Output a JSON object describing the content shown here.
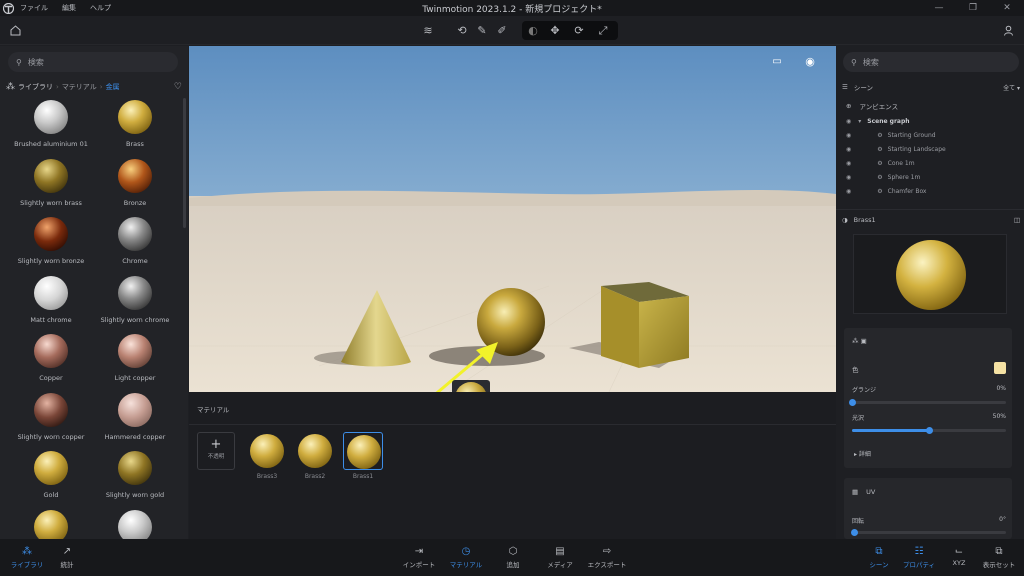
{
  "titlebar": {
    "app_title": "Twinmotion 2023.1.2 - 新規プロジェクト*",
    "menus": [
      "ファイル",
      "編集",
      "ヘルプ"
    ]
  },
  "left_panel": {
    "search_placeholder": "検索",
    "breadcrumb": {
      "root": "ライブラリ",
      "mid": "マテリアル",
      "current": "金属"
    },
    "materials": [
      {
        "label": "Brushed aluminium 01",
        "style": "silver"
      },
      {
        "label": "Brass",
        "style": "gold"
      },
      {
        "label": "Slightly worn brass",
        "style": "darkgold"
      },
      {
        "label": "Bronze",
        "style": "bronze"
      },
      {
        "label": "Slightly worn bronze",
        "style": "darkbronze"
      },
      {
        "label": "Chrome",
        "style": "chrome"
      },
      {
        "label": "Matt chrome",
        "style": "matt"
      },
      {
        "label": "Slightly worn chrome",
        "style": "chrome"
      },
      {
        "label": "Copper",
        "style": "copper"
      },
      {
        "label": "Light copper",
        "style": "lightcopper"
      },
      {
        "label": "Slightly worn copper",
        "style": "darkcopper"
      },
      {
        "label": "Hammered copper",
        "style": "hammered"
      },
      {
        "label": "Gold",
        "style": "gold"
      },
      {
        "label": "Slightly worn gold",
        "style": "darkgold"
      },
      {
        "label": "",
        "style": "gold"
      },
      {
        "label": "",
        "style": "silver"
      }
    ]
  },
  "material_bar": {
    "title": "マテリアル",
    "add_label": "不透明",
    "items": [
      {
        "label": "Brass3",
        "selected": false
      },
      {
        "label": "Brass2",
        "selected": false
      },
      {
        "label": "Brass1",
        "selected": true
      }
    ]
  },
  "right_panel": {
    "search_placeholder": "検索",
    "scene_title": "シーン",
    "filter_label": "全て",
    "ambience_label": "アンビエンス",
    "scene_graph_label": "Scene graph",
    "scene_items": [
      "Starting Ground",
      "Starting Landscape",
      "Cone 1m",
      "Sphere 1m",
      "Chamfer Box"
    ],
    "material_name": "Brass1",
    "color_label": "色",
    "glossiness_label": "グランジ",
    "glossiness_value": "0%",
    "glossiness": 0,
    "shine_label": "光沢",
    "shine_value": "50%",
    "shine": 0.5,
    "details_label": "詳細",
    "uv_label": "UV",
    "rotation_label": "回転",
    "rotation_value": "0°",
    "swatch_color": "#f5e2a4"
  },
  "bottom_bar": {
    "left": [
      {
        "label": "ライブラリ",
        "active": true
      },
      {
        "label": "統計",
        "active": false
      }
    ],
    "center": [
      {
        "label": "インポート",
        "active": false
      },
      {
        "label": "マテリアル",
        "active": true
      },
      {
        "label": "追加",
        "active": false
      },
      {
        "label": "メディア",
        "active": false
      },
      {
        "label": "エクスポート",
        "active": false
      }
    ],
    "right": [
      {
        "label": "シーン",
        "active": true
      },
      {
        "label": "プロパティ",
        "active": true
      },
      {
        "label": "XYZ",
        "active": false
      },
      {
        "label": "表示セット",
        "active": false
      }
    ]
  },
  "colors": {
    "accent": "#3d8ee8",
    "arrow": "#f2f22a"
  }
}
